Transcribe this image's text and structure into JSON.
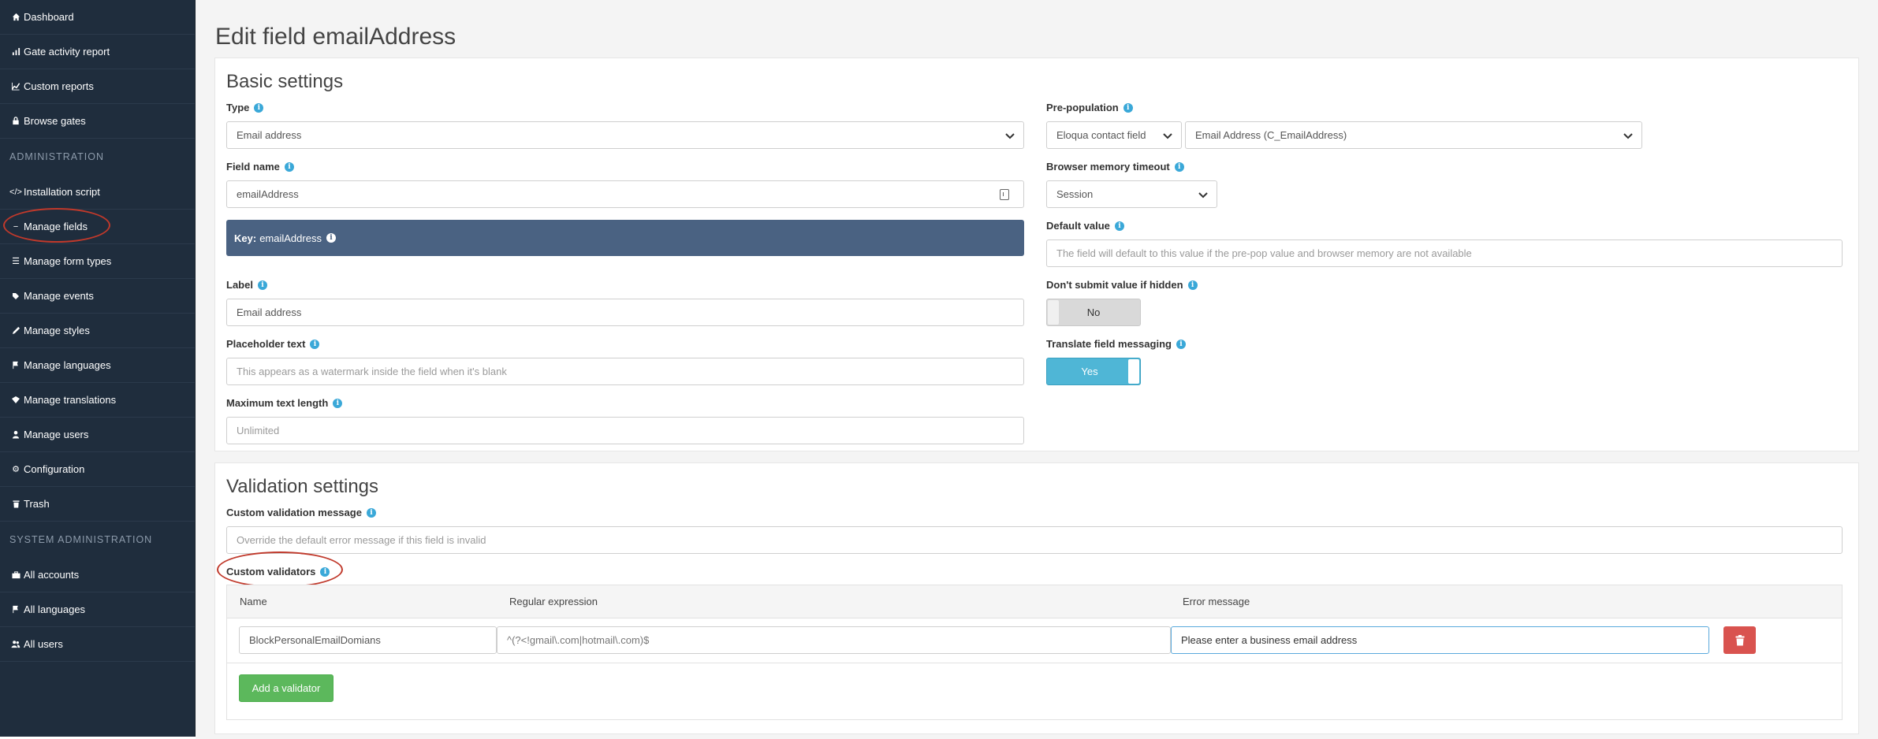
{
  "sidebar": {
    "items": [
      {
        "label": "Dashboard",
        "icon": "home-icon"
      },
      {
        "label": "Gate activity report",
        "icon": "bar-chart-icon"
      },
      {
        "label": "Custom reports",
        "icon": "line-chart-icon"
      },
      {
        "label": "Browse gates",
        "icon": "lock-icon"
      }
    ],
    "admin_heading": "ADMINISTRATION",
    "admin_items": [
      {
        "label": "Installation script",
        "icon": "code-icon"
      },
      {
        "label": "Manage fields",
        "icon": "minus-icon"
      },
      {
        "label": "Manage form types",
        "icon": "list-icon"
      },
      {
        "label": "Manage events",
        "icon": "tag-icon"
      },
      {
        "label": "Manage styles",
        "icon": "pencil-icon"
      },
      {
        "label": "Manage languages",
        "icon": "flag-icon"
      },
      {
        "label": "Manage translations",
        "icon": "language-icon"
      },
      {
        "label": "Manage users",
        "icon": "user-icon"
      },
      {
        "label": "Configuration",
        "icon": "gear-icon"
      },
      {
        "label": "Trash",
        "icon": "trash-icon"
      }
    ],
    "sysadmin_heading": "SYSTEM ADMINISTRATION",
    "sysadmin_items": [
      {
        "label": "All accounts",
        "icon": "briefcase-icon"
      },
      {
        "label": "All languages",
        "icon": "flag-icon"
      },
      {
        "label": "All users",
        "icon": "users-icon"
      }
    ]
  },
  "page": {
    "title": "Edit field emailAddress"
  },
  "basic": {
    "title": "Basic settings",
    "type_label": "Type",
    "type_value": "Email address",
    "field_name_label": "Field name",
    "field_name_value": "emailAddress",
    "key_label": "Key:",
    "key_value": "emailAddress",
    "label_label": "Label",
    "label_value": "Email address",
    "placeholder_label": "Placeholder text",
    "placeholder_placeholder": "This appears as a watermark inside the field when it's blank",
    "maxlen_label": "Maximum text length",
    "maxlen_placeholder": "Unlimited",
    "prepop_label": "Pre-population",
    "prepop_source": "Eloqua contact field",
    "prepop_field": "Email Address (C_EmailAddress)",
    "memory_label": "Browser memory timeout",
    "memory_value": "Session",
    "default_label": "Default value",
    "default_placeholder": "The field will default to this value if the pre-pop value and browser memory are not available",
    "dont_submit_label": "Don't submit value if hidden",
    "dont_submit_value": "No",
    "translate_label": "Translate field messaging",
    "translate_value": "Yes"
  },
  "validation": {
    "title": "Validation settings",
    "custom_msg_label": "Custom validation message",
    "custom_msg_placeholder": "Override the default error message if this field is invalid",
    "validators_label": "Custom validators",
    "columns": {
      "name": "Name",
      "regex": "Regular expression",
      "error": "Error message"
    },
    "rows": [
      {
        "name": "BlockPersonalEmailDomians",
        "regex": "^(?<!gmail\\.com|hotmail\\.com)$",
        "error": "Please enter a business email address"
      }
    ],
    "add_button": "Add a validator"
  },
  "colors": {
    "sidebar": "#1f2d3d",
    "accent": "#4fb6d6",
    "danger": "#d9534f",
    "success": "#5cb85c",
    "annotation": "#c0392b"
  }
}
